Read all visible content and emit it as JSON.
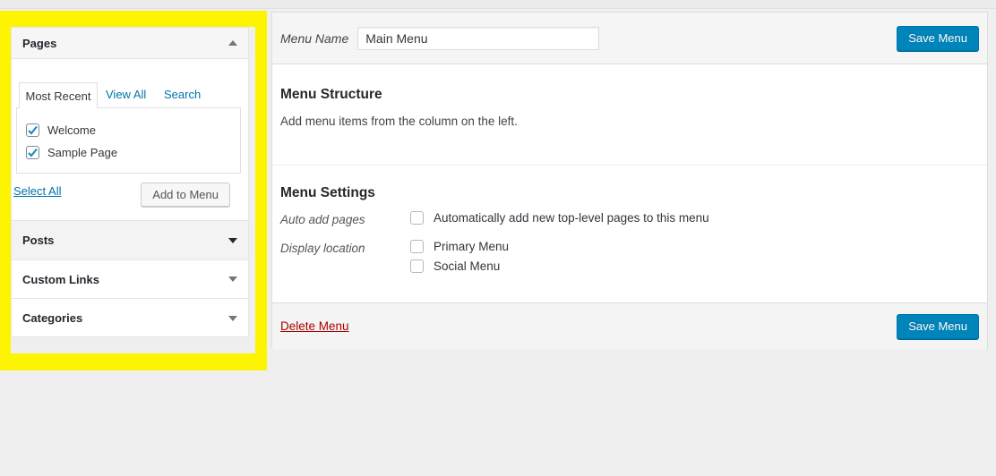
{
  "highlight_color": "#fdf403",
  "sidebar": {
    "pages_panel": {
      "title": "Pages",
      "tabs": {
        "most_recent": "Most Recent",
        "view_all": "View All",
        "search": "Search"
      },
      "items": [
        {
          "label": "Welcome",
          "checked": true
        },
        {
          "label": "Sample Page",
          "checked": true
        }
      ],
      "select_all_label": "Select All",
      "add_to_menu_label": "Add to Menu"
    },
    "accordions": [
      {
        "label": "Posts"
      },
      {
        "label": "Custom Links"
      },
      {
        "label": "Categories"
      }
    ]
  },
  "editor": {
    "menu_name_label": "Menu Name",
    "menu_name_value": "Main Menu",
    "save_button_label": "Save Menu",
    "structure": {
      "title": "Menu Structure",
      "description": "Add menu items from the column on the left."
    },
    "settings": {
      "title": "Menu Settings",
      "auto_add": {
        "label": "Auto add pages",
        "checkbox_label": "Automatically add new top-level pages to this menu",
        "checked": false
      },
      "display_location": {
        "label": "Display location",
        "options": [
          {
            "label": "Primary Menu",
            "checked": false
          },
          {
            "label": "Social Menu",
            "checked": false
          }
        ]
      }
    },
    "footer": {
      "delete_label": "Delete Menu",
      "save_label": "Save Menu"
    }
  },
  "colors": {
    "accent_blue": "#0085ba",
    "link_blue": "#0073aa",
    "check_blue": "#1e8cbe",
    "delete_red": "#a00000",
    "highlight_yellow": "#fdf403"
  }
}
